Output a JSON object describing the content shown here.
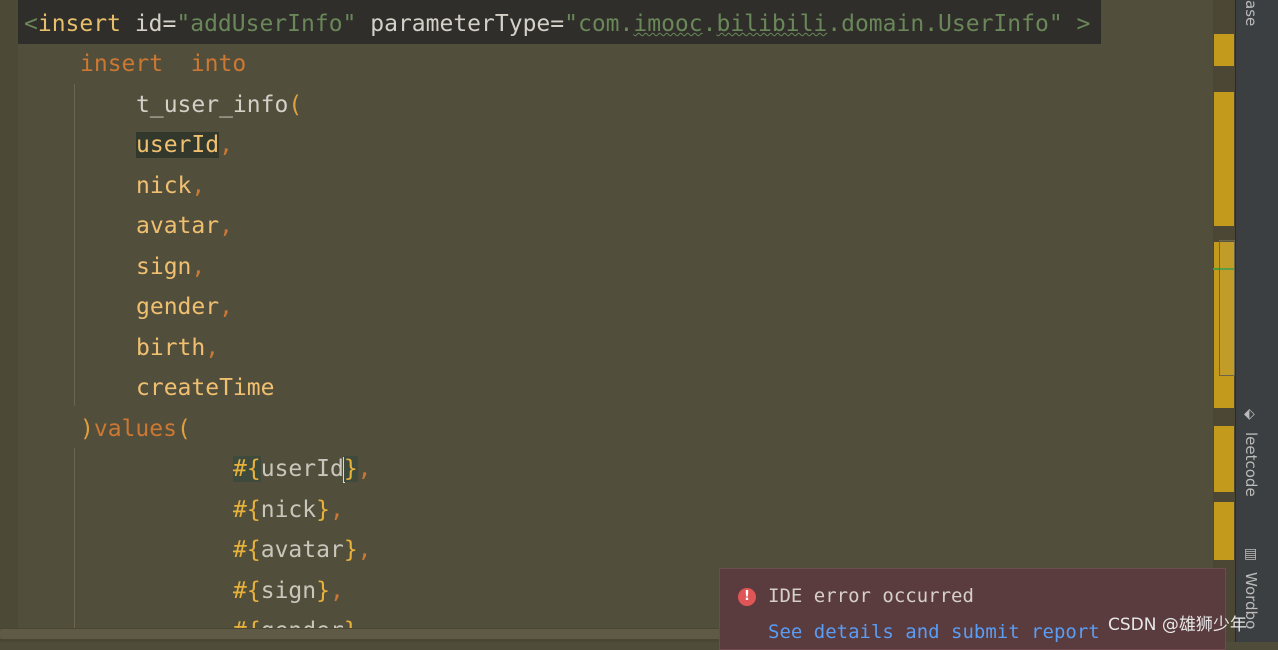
{
  "editor": {
    "tag_line": {
      "open": "<",
      "tag": "insert",
      "attr_id": "id",
      "eq": "=",
      "id_value": "\"addUserInfo\"",
      "attr_param": "parameterType",
      "param_value_prefix": "\"com.",
      "param_imooc": "imooc",
      "param_dot1": ".",
      "param_bilibili": "bilibili",
      "param_rest": ".domain.UserInfo\"",
      "close": ">"
    },
    "insert_kw": "insert",
    "into_kw": "into",
    "table": "t_user_info",
    "open_paren": "(",
    "comma": ",",
    "columns": [
      "userId",
      "nick",
      "avatar",
      "sign",
      "gender",
      "birth",
      "createTime"
    ],
    "values_close": ")",
    "values_kw": "values",
    "values_open": "(",
    "hash": "#",
    "lbrace": "{",
    "rbrace": "}",
    "params": [
      "userId",
      "nick",
      "avatar",
      "sign",
      "gender"
    ]
  },
  "right_bar": {
    "tab_top": "ase",
    "tab_leetcode": "leetcode",
    "tab_word": "Wordbo"
  },
  "notification": {
    "title": "IDE error occurred",
    "link": "See details and submit report",
    "icon": "error-icon"
  },
  "watermark": "CSDN @雄狮少年",
  "colors": {
    "editor_bg": "#524e3c",
    "keyword": "#cc7832",
    "string": "#6a8759",
    "marker": "#c49a1c",
    "notification_bg": "#5a3b3e",
    "link": "#589df6"
  }
}
